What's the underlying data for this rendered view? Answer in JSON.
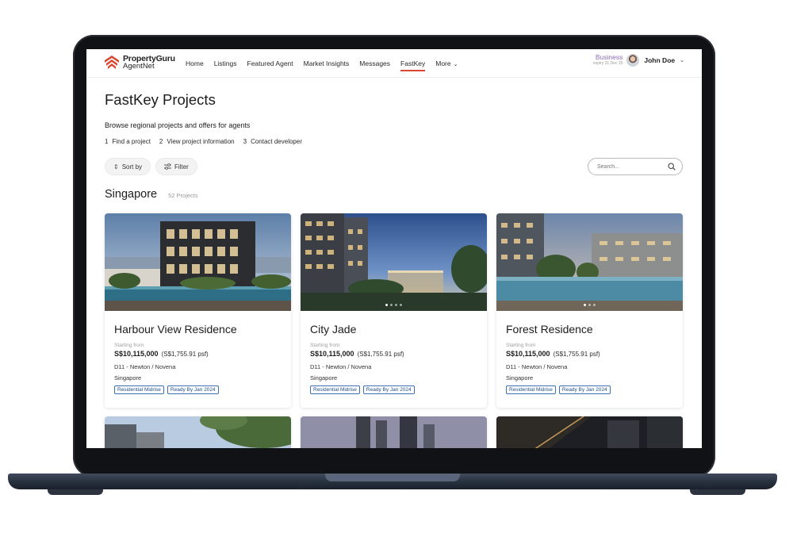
{
  "brand": {
    "name": "PropertyGuru",
    "sub": "AgentNet",
    "accent": "#d94732"
  },
  "nav": {
    "links": [
      {
        "label": "Home"
      },
      {
        "label": "Listings"
      },
      {
        "label": "Featured Agent"
      },
      {
        "label": "Market Insights"
      },
      {
        "label": "Messages"
      },
      {
        "label": "FastKey"
      },
      {
        "label": "More"
      }
    ],
    "active": "FastKey"
  },
  "account": {
    "plan": "Business",
    "plan_expiry": "expiry 31 Dec 25",
    "user_name": "John Doe"
  },
  "page": {
    "title": "FastKey Projects",
    "subtitle": "Browse regional projects and offers for agents",
    "steps": [
      {
        "num": "1",
        "label": "Find a project"
      },
      {
        "num": "2",
        "label": "View project information"
      },
      {
        "num": "3",
        "label": "Contact developer"
      }
    ]
  },
  "controls": {
    "sort_label": "Sort by",
    "filter_label": "Filter",
    "search_placeholder": "Search..."
  },
  "section": {
    "title": "Singapore",
    "count": "52 Projects"
  },
  "projects": [
    {
      "name": "Harbour View Residence",
      "starting_label": "Starting from",
      "price": "S$10,115,000",
      "psf": "(S$1,755.91 psf)",
      "district": "D11 - Newton / Novena",
      "city": "Singapore",
      "tags": [
        "Residential Midrise",
        "Ready By Jan 2024"
      ]
    },
    {
      "name": "City Jade",
      "starting_label": "Starting from",
      "price": "S$10,115,000",
      "psf": "(S$1,755.91 psf)",
      "district": "D11 - Newton / Novena",
      "city": "Singapore",
      "tags": [
        "Residential Midrise",
        "Ready By Jan 2024"
      ]
    },
    {
      "name": "Forest Residence",
      "starting_label": "Starting from",
      "price": "S$10,115,000",
      "psf": "(S$1,755.91 psf)",
      "district": "D11 - Newton / Novena",
      "city": "Singapore",
      "tags": [
        "Residential Midrise",
        "Ready By Jan 2024"
      ]
    }
  ],
  "icons": {
    "logo": "propertyguru-logo-icon",
    "more": "chevron-down-icon",
    "sort": "sort-arrows-icon",
    "filter": "filter-sliders-icon",
    "search": "search-icon",
    "user": "avatar"
  },
  "colors": {
    "business_label": "#8a6cb6",
    "tag_border": "#3d6fb0",
    "tag_text": "#1f4e8c"
  }
}
